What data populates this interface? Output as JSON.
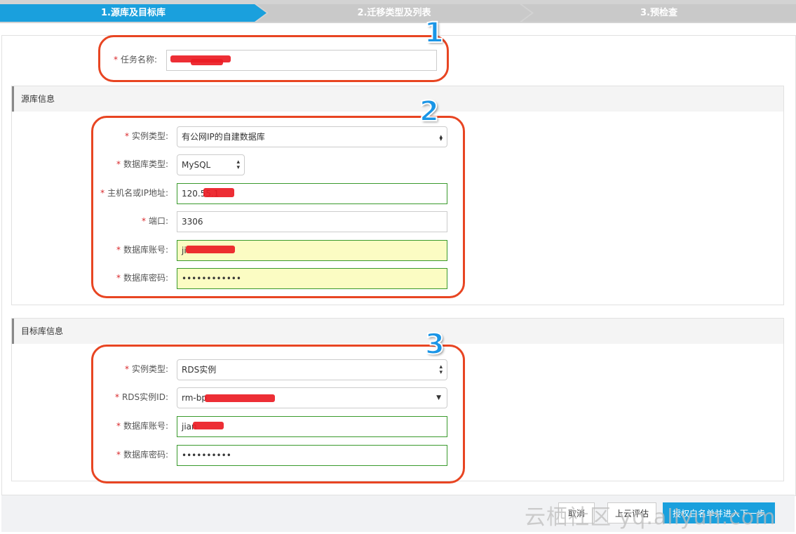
{
  "steps": {
    "step1": "1.源库及目标库",
    "step2": "2.迁移类型及列表",
    "step3": "3.预检查"
  },
  "required_mark": "*",
  "task": {
    "label": "任务名称:",
    "value": ""
  },
  "source": {
    "title": "源库信息",
    "instance_type_label": "实例类型:",
    "instance_type_value": "有公网IP的自建数据库",
    "db_type_label": "数据库类型:",
    "db_type_value": "MySQL",
    "host_label": "主机名或IP地址:",
    "host_value": "120.55.1",
    "port_label": "端口:",
    "port_value": "3306",
    "account_label": "数据库账号:",
    "account_value": "ji",
    "password_label": "数据库密码:",
    "password_value": "••••••••••••"
  },
  "target": {
    "title": "目标库信息",
    "instance_type_label": "实例类型:",
    "instance_type_value": "RDS实例",
    "rds_id_label": "RDS实例ID:",
    "rds_id_value": "rm-bp",
    "account_label": "数据库账号:",
    "account_value": "jian",
    "password_label": "数据库密码:",
    "password_value": "••••••••••"
  },
  "annotations": [
    "1",
    "2",
    "3"
  ],
  "footer": {
    "cancel": "取消",
    "evaluate": "上云评估",
    "next": "授权白名单并进入下一步",
    "watermark": "云栖社区 yq.aliyun.com"
  },
  "colors": {
    "accent": "#1aa0dd",
    "annotation_border": "#e84522",
    "annotation_number": "#1a95e6",
    "required": "#d9282b",
    "valid_border": "#3a9a2c",
    "autofill_bg": "#fbfcc3",
    "redaction": "#ec1c24"
  },
  "icons": {
    "select_arrows": "updown-arrows-icon",
    "dropdown": "caret-down-icon"
  }
}
